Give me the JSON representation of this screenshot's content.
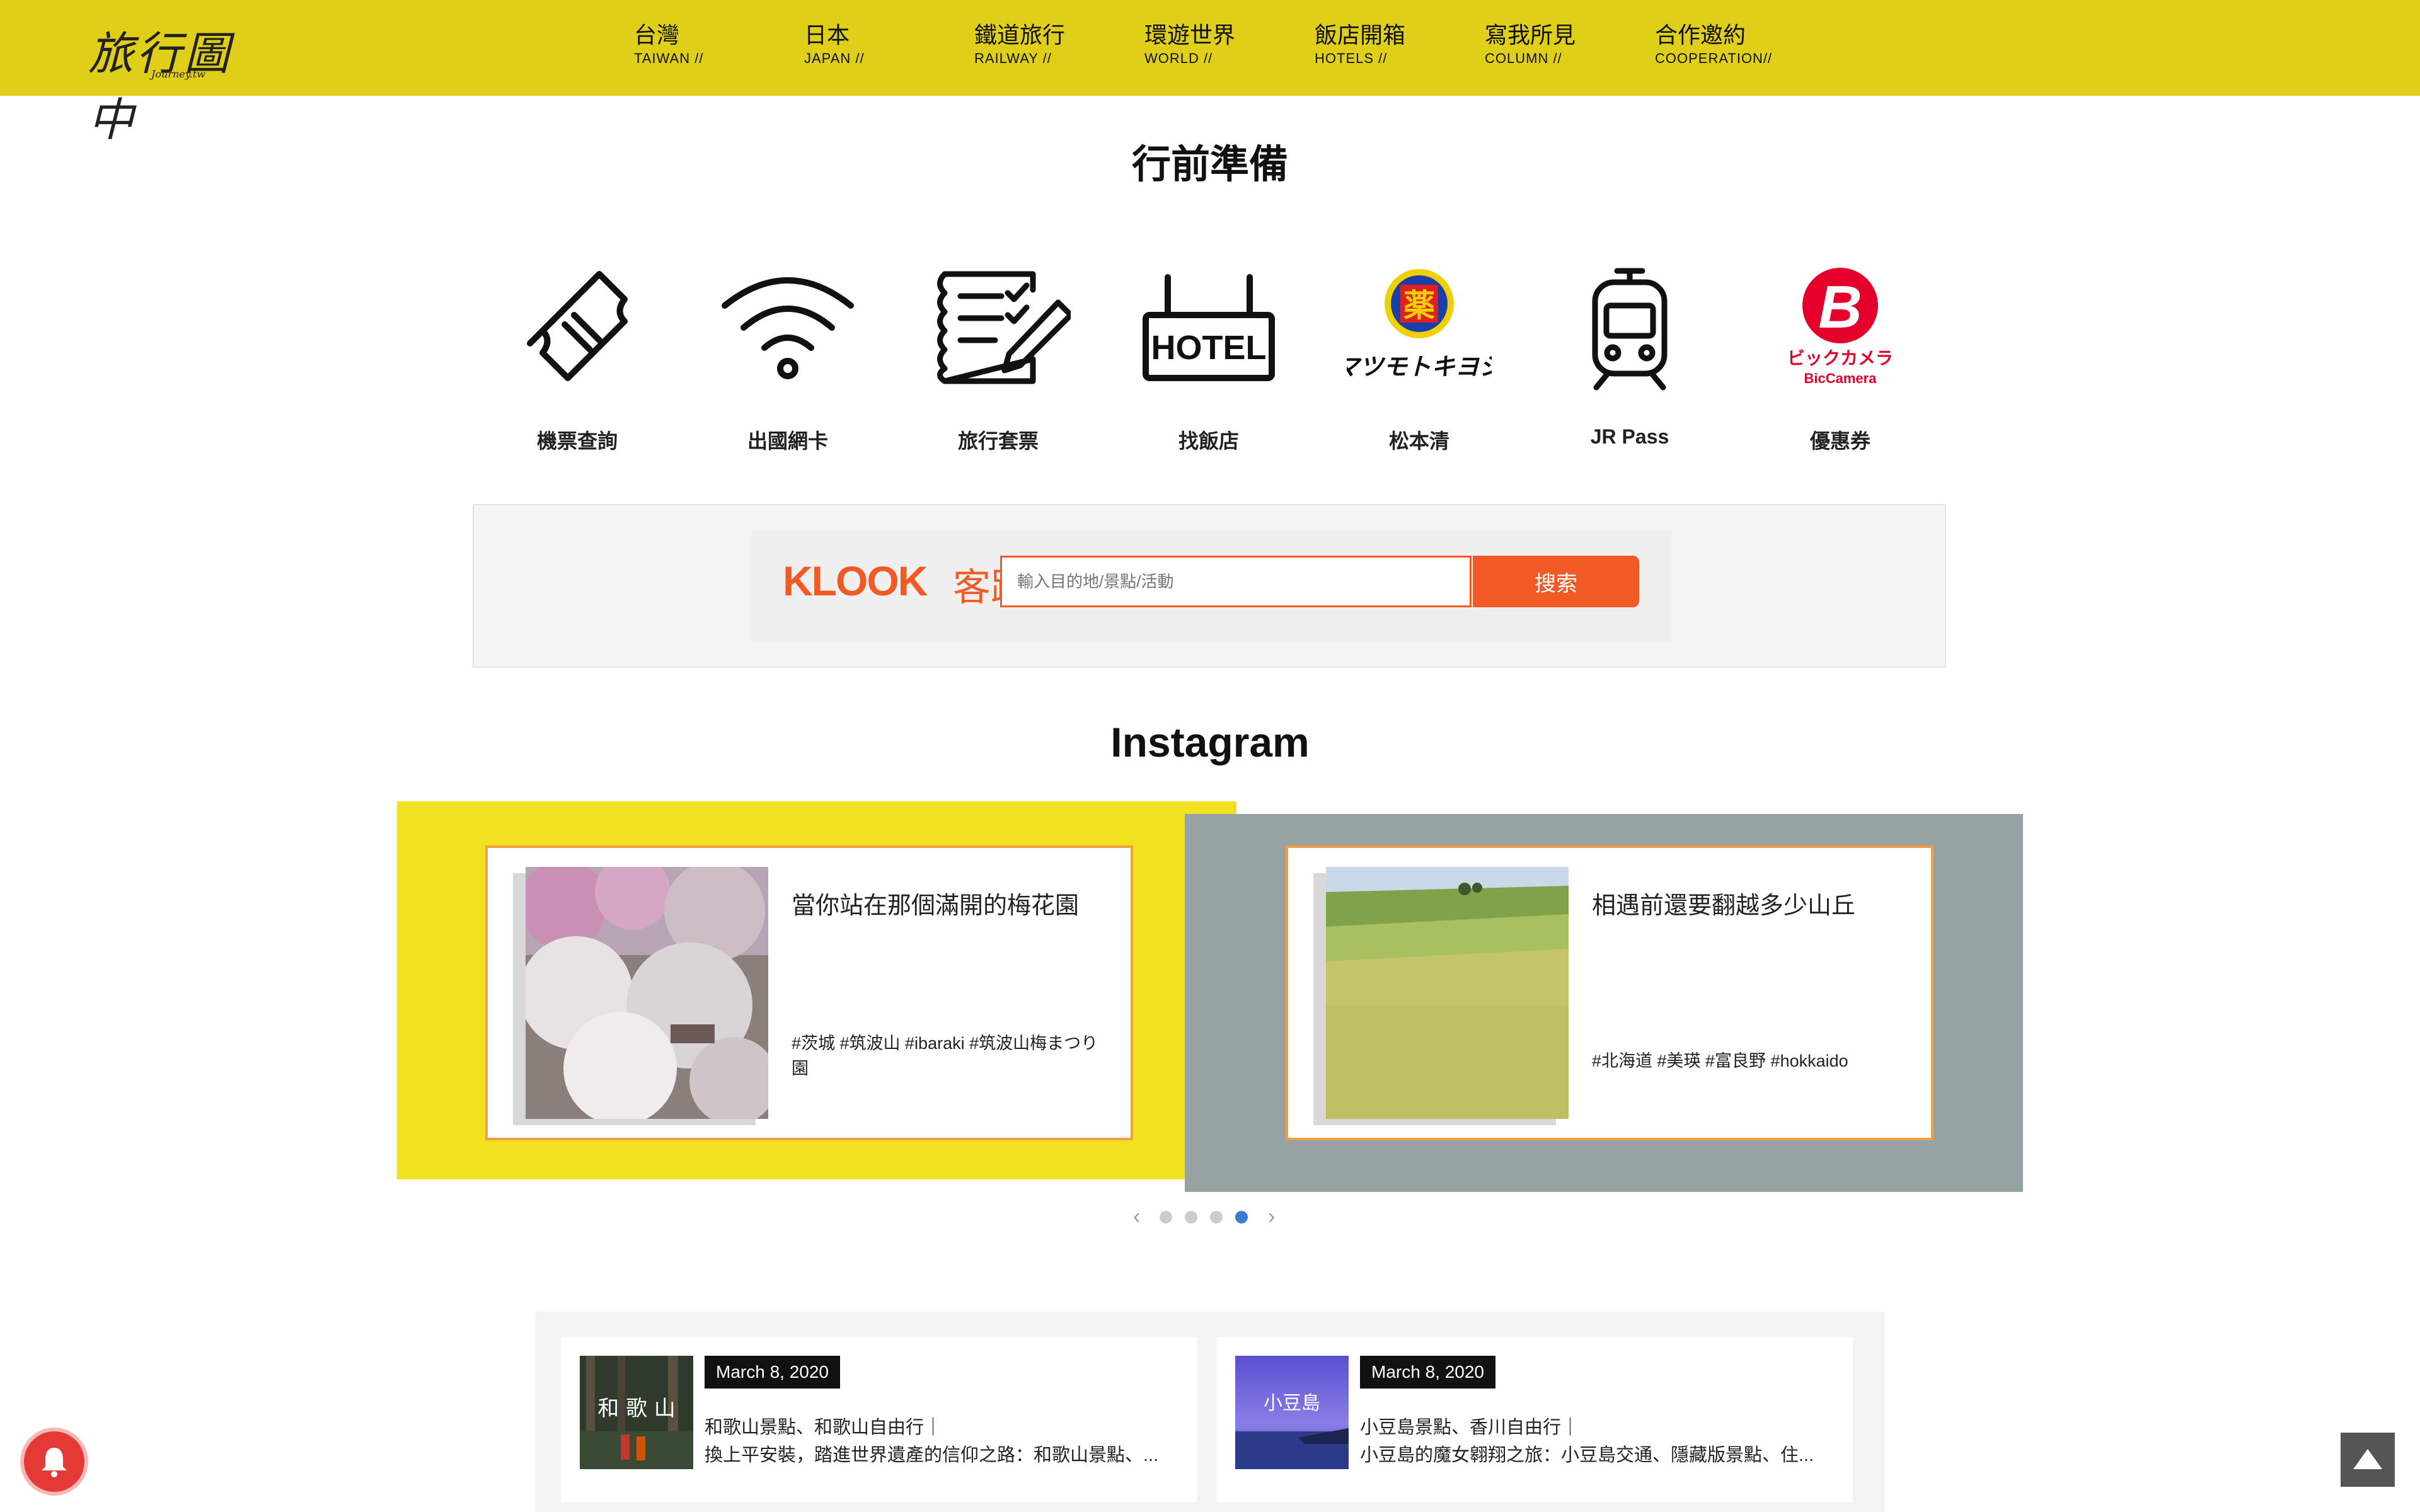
{
  "header": {
    "logo": "旅行圖中",
    "logo_sub": "Journey.tw",
    "nav": [
      {
        "zh": "台灣",
        "en": "TAIWAN //"
      },
      {
        "zh": "日本",
        "en": "JAPAN //"
      },
      {
        "zh": "鐵道旅行",
        "en": "RAILWAY //"
      },
      {
        "zh": "環遊世界",
        "en": "WORLD //"
      },
      {
        "zh": "飯店開箱",
        "en": "HOTELS //"
      },
      {
        "zh": "寫我所見",
        "en": "COLUMN //"
      },
      {
        "zh": "合作邀約",
        "en": "COOPERATION//"
      }
    ]
  },
  "prep": {
    "title": "行前準備",
    "items": [
      {
        "label": "機票查詢",
        "icon": "ticket-icon"
      },
      {
        "label": "出國網卡",
        "icon": "wifi-icon"
      },
      {
        "label": "旅行套票",
        "icon": "checklist-icon"
      },
      {
        "label": "找飯店",
        "icon": "hotel-sign-icon",
        "icon_text": "HOTEL"
      },
      {
        "label": "松本清",
        "icon": "matsukiyo-logo",
        "icon_text": "薬",
        "icon_sub": "マツモトキヨシ"
      },
      {
        "label": "JR Pass",
        "icon": "train-icon"
      },
      {
        "label": "優惠券",
        "icon": "biccamera-logo",
        "icon_text": "B",
        "icon_sub": "ビックカメラ",
        "icon_sub2": "BicCamera"
      }
    ]
  },
  "klook": {
    "brand": "KLOOK",
    "brand_zh": "客路",
    "placeholder": "輸入目的地/景點/活動",
    "button": "搜索"
  },
  "instagram": {
    "title": "Instagram",
    "posts": [
      {
        "caption": "當你站在那個滿開的梅花園",
        "tags": "#茨城 #筑波山 #ibaraki #筑波山梅まつり 園"
      },
      {
        "caption": "相遇前還要翻越多少山丘",
        "tags": "#北海道 #美瑛 #富良野 #hokkaido"
      }
    ],
    "dots": 4,
    "active_dot": 4
  },
  "news": [
    {
      "date": "March 8, 2020",
      "thumb_text": "和 歌 山",
      "line1": "和歌山景點、和歌山自由行｜",
      "line2": "換上平安裝，踏進世界遺產的信仰之路：和歌山景點、..."
    },
    {
      "date": "March 8, 2020",
      "thumb_text": "小豆島",
      "line1": "小豆島景點、香川自由行｜",
      "line2": "小豆島的魔女翱翔之旅：小豆島交通、隱藏版景點、住..."
    }
  ],
  "colors": {
    "header": "#e0cf18",
    "klook_orange": "#f15a24",
    "ig_yellow": "#f1e121",
    "ig_gray": "#96a3a2",
    "dot_active": "#3d7ad2"
  }
}
